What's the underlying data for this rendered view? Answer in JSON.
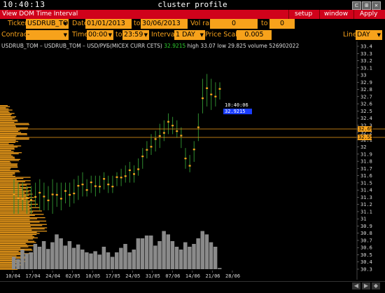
{
  "titlebar": {
    "time": "10:40:13",
    "title": "cluster profile",
    "buttons": [
      "⊏",
      "⊞",
      "✕"
    ]
  },
  "menubar": {
    "title": "View DOM Time Interval",
    "items": [
      "setup",
      "window",
      "Apply"
    ]
  },
  "toolbar": {
    "ticker_label": "Ticker",
    "ticker_value": "USDRUB_TO",
    "date_label": "Date",
    "date_from": "01/01/2013",
    "to_label": "to",
    "date_to": "30/06/2013",
    "volrange_label": "Vol range",
    "volrange_from": "0",
    "volrange_to_label": "to",
    "volrange_to": "0",
    "contract_label": "Contract",
    "contract_value": "-",
    "time_label": "Time",
    "time_from": "00:00",
    "time_to_label": "to",
    "time_to": "23:59",
    "interval_label": "Interval",
    "interval_value": "1 DAY",
    "pricescale_label": "Price Scale",
    "pricescale_value": "0.005",
    "line_label": "Line",
    "line_value": "DAY",
    "dropdown_glyph": "▼"
  },
  "info": {
    "symbol": "USDRUB_TOM – USDRUB_TOM – USD/РУБ(MICEX CURR CETS)",
    "last": "32.9215",
    "high": "high 33.07",
    "low": "low 29.825",
    "volume": "volume 526902022"
  },
  "cursor": {
    "time": "10:40:06",
    "price": "32.9215"
  },
  "price_tags": [
    "32.69",
    "32.55"
  ],
  "colors": {
    "accent": "#f7a21b",
    "menu": "#d0021b",
    "up": "#2fd12f",
    "cursor_box": "#1a3dff"
  },
  "chart_data": {
    "type": "candlestick",
    "y_ticks": [
      "33.4",
      "33.3",
      "33.2",
      "33.1",
      "33",
      "32.9",
      "32.8",
      "32.7",
      "32.6",
      "32.5",
      "32.4",
      "32.3",
      "32.2",
      "32.1",
      "32",
      "31.9",
      "31.8",
      "31.7",
      "31.6",
      "31.5",
      "31.4",
      "31.3",
      "31.2",
      "31.1",
      "31",
      "30.9",
      "30.8",
      "30.7",
      "30.6",
      "30.5",
      "30.4",
      "30.3"
    ],
    "x_ticks": [
      "10/04",
      "17/04",
      "24/04",
      "02/05",
      "10/05",
      "17/05",
      "24/05",
      "31/05",
      "07/06",
      "14/06",
      "21/06",
      "28/06"
    ],
    "ylim": [
      30.25,
      33.47
    ],
    "candles": [
      {
        "h": 31.55,
        "l": 31.05,
        "v": 0.22
      },
      {
        "h": 31.5,
        "l": 31.05,
        "v": 0.18
      },
      {
        "h": 31.5,
        "l": 31.1,
        "v": 0.35
      },
      {
        "h": 31.45,
        "l": 31.05,
        "v": 0.28
      },
      {
        "h": 31.45,
        "l": 31.05,
        "v": 0.3
      },
      {
        "h": 31.5,
        "l": 31.15,
        "v": 0.45
      },
      {
        "h": 31.55,
        "l": 31.1,
        "v": 0.4
      },
      {
        "h": 31.5,
        "l": 31.1,
        "v": 0.5
      },
      {
        "h": 31.45,
        "l": 31.1,
        "v": 0.36
      },
      {
        "h": 31.55,
        "l": 31.05,
        "v": 0.48
      },
      {
        "h": 31.5,
        "l": 31.15,
        "v": 0.62
      },
      {
        "h": 31.5,
        "l": 31.1,
        "v": 0.55
      },
      {
        "h": 31.5,
        "l": 31.2,
        "v": 0.42
      },
      {
        "h": 31.5,
        "l": 31.15,
        "v": 0.5
      },
      {
        "h": 31.55,
        "l": 31.2,
        "v": 0.38
      },
      {
        "h": 31.6,
        "l": 31.25,
        "v": 0.44
      },
      {
        "h": 31.65,
        "l": 31.3,
        "v": 0.35
      },
      {
        "h": 31.55,
        "l": 31.3,
        "v": 0.3
      },
      {
        "h": 31.6,
        "l": 31.35,
        "v": 0.28
      },
      {
        "h": 31.6,
        "l": 31.3,
        "v": 0.32
      },
      {
        "h": 31.6,
        "l": 31.35,
        "v": 0.26
      },
      {
        "h": 31.65,
        "l": 31.4,
        "v": 0.4
      },
      {
        "h": 31.6,
        "l": 31.35,
        "v": 0.3
      },
      {
        "h": 31.6,
        "l": 31.35,
        "v": 0.22
      },
      {
        "h": 31.65,
        "l": 31.45,
        "v": 0.3
      },
      {
        "h": 31.7,
        "l": 31.45,
        "v": 0.38
      },
      {
        "h": 31.75,
        "l": 31.5,
        "v": 0.45
      },
      {
        "h": 31.8,
        "l": 31.5,
        "v": 0.3
      },
      {
        "h": 31.75,
        "l": 31.5,
        "v": 0.35
      },
      {
        "h": 31.85,
        "l": 31.6,
        "v": 0.55
      },
      {
        "h": 32.0,
        "l": 31.7,
        "v": 0.55
      },
      {
        "h": 32.1,
        "l": 31.85,
        "v": 0.6
      },
      {
        "h": 32.2,
        "l": 31.9,
        "v": 0.6
      },
      {
        "h": 32.25,
        "l": 31.95,
        "v": 0.42
      },
      {
        "h": 32.35,
        "l": 32.0,
        "v": 0.5
      },
      {
        "h": 32.4,
        "l": 32.1,
        "v": 0.68
      },
      {
        "h": 32.5,
        "l": 32.2,
        "v": 0.62
      },
      {
        "h": 32.45,
        "l": 32.2,
        "v": 0.5
      },
      {
        "h": 32.4,
        "l": 32.15,
        "v": 0.4
      },
      {
        "h": 32.3,
        "l": 32.0,
        "v": 0.35
      },
      {
        "h": 32.0,
        "l": 31.7,
        "v": 0.48
      },
      {
        "h": 31.9,
        "l": 31.65,
        "v": 0.4
      },
      {
        "h": 32.1,
        "l": 31.8,
        "v": 0.45
      },
      {
        "h": 32.5,
        "l": 32.1,
        "v": 0.55
      },
      {
        "h": 33.0,
        "l": 32.5,
        "v": 0.68
      },
      {
        "h": 33.07,
        "l": 32.6,
        "v": 0.62
      },
      {
        "h": 33.0,
        "l": 32.55,
        "v": 0.48
      },
      {
        "h": 32.95,
        "l": 32.6,
        "v": 0.4
      },
      {
        "h": 32.95,
        "l": 32.7,
        "v": 0.02
      }
    ]
  }
}
